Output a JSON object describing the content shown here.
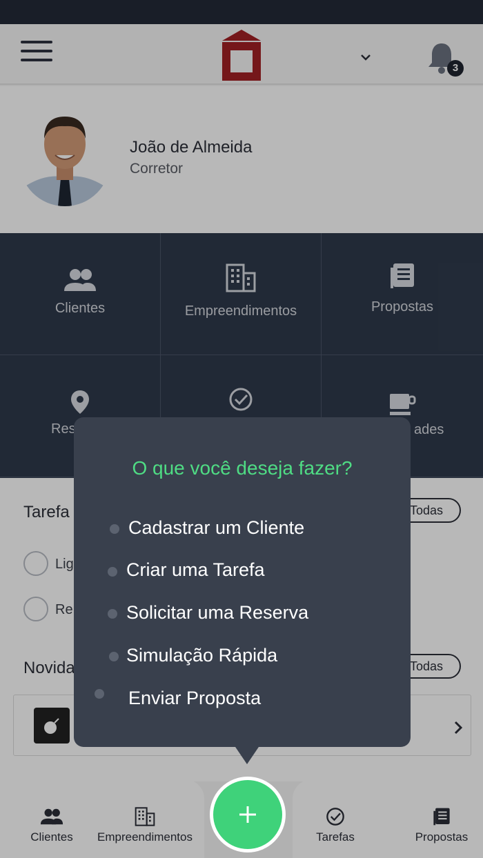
{
  "header": {
    "notification_count": "3",
    "colors": {
      "logo": "#a32024",
      "header_bg": "#f7f7f7"
    }
  },
  "profile": {
    "name": "João de Almeida",
    "role": "Corretor"
  },
  "tiles": [
    {
      "label": "Clientes",
      "icon": "people-icon"
    },
    {
      "label": "Empreendimentos",
      "icon": "building-icon"
    },
    {
      "label": "Propostas",
      "icon": "document-icon"
    },
    {
      "label": "Res",
      "icon": "location-pin-icon"
    },
    {
      "label": "",
      "icon": "check-circle-icon"
    },
    {
      "label": "ades",
      "icon": "coffee-cup-icon"
    }
  ],
  "sections": {
    "tasks_title": "Tarefa",
    "news_title": "Novida",
    "view_all_label": "Todas"
  },
  "tasks": [
    {
      "text": "Lig"
    },
    {
      "text": "Re"
    }
  ],
  "popup": {
    "title": "O que você deseja fazer?",
    "options": [
      "Cadastrar um Cliente",
      "Criar uma Tarefa",
      "Solicitar uma Reserva",
      "Simulação Rápida",
      "Enviar Proposta"
    ]
  },
  "bottom_nav": {
    "items": [
      {
        "label": "Clientes",
        "icon": "people-icon"
      },
      {
        "label": "Empreendimentos",
        "icon": "building-icon"
      },
      {
        "label": "Tarefas",
        "icon": "check-circle-icon"
      },
      {
        "label": "Propostas",
        "icon": "document-icon"
      }
    ],
    "fab_icon": "plus-icon",
    "colors": {
      "fab": "#3fd27a",
      "accent_text": "#4fdc84"
    }
  }
}
